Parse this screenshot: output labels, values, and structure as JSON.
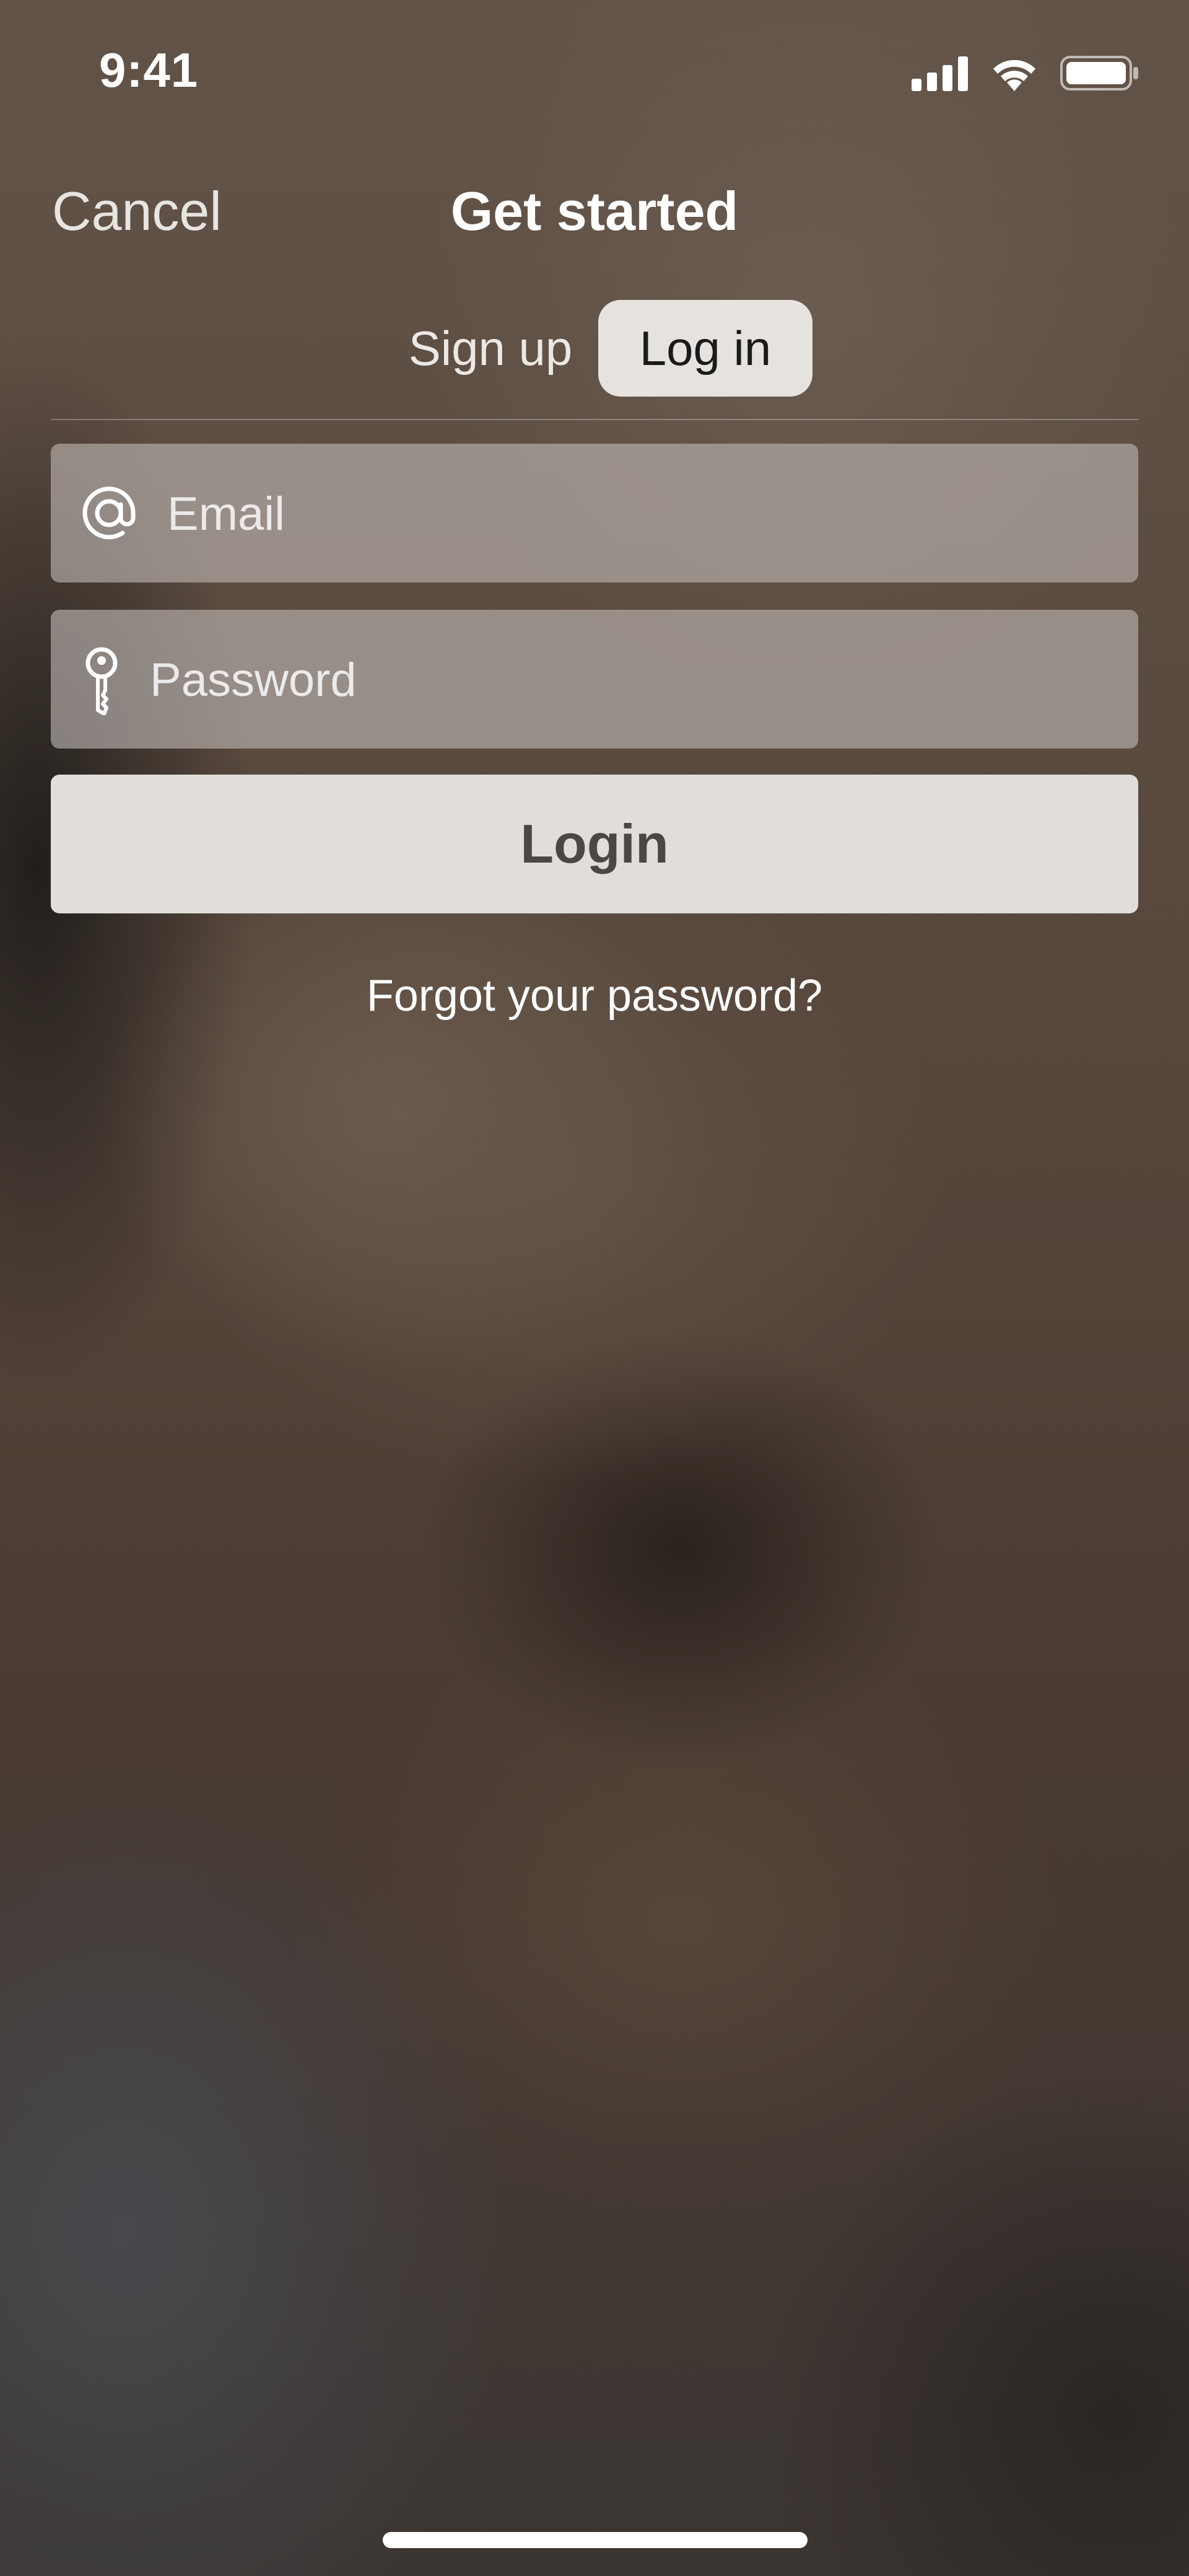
{
  "status_bar": {
    "time": "9:41",
    "icons": [
      "cellular-signal-icon",
      "wifi-icon",
      "battery-icon"
    ]
  },
  "nav": {
    "cancel_label": "Cancel",
    "title": "Get started"
  },
  "segmented": {
    "options": [
      "Sign up",
      "Log in"
    ],
    "selected": "Log in"
  },
  "form": {
    "email": {
      "placeholder": "Email",
      "value": "",
      "icon": "at-sign-icon"
    },
    "password": {
      "placeholder": "Password",
      "value": "",
      "icon": "key-icon"
    },
    "login_label": "Login",
    "forgot_label": "Forgot your password?"
  },
  "colors": {
    "selected_segment_bg": "#e6e2de",
    "field_bg": "#beb8b4",
    "button_bg": "#e0ddda",
    "button_text": "#4a4745"
  }
}
